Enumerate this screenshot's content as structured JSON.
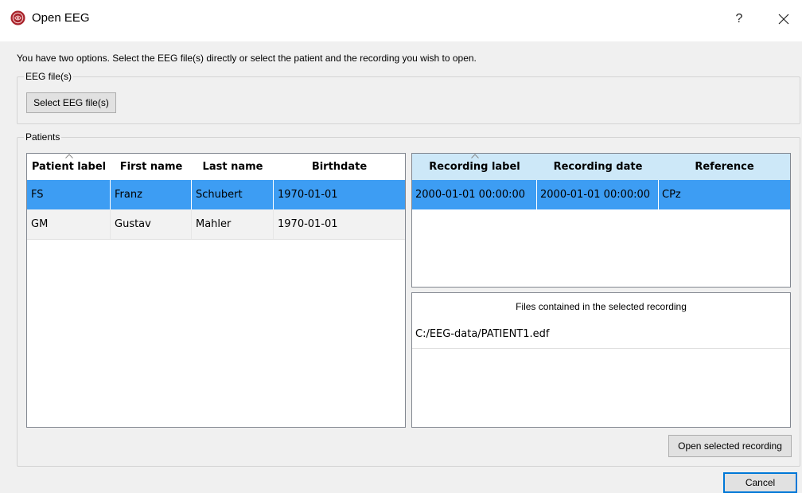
{
  "window": {
    "title": "Open EEG",
    "help_label": "?",
    "close_label": "✕",
    "icon": "brain-app-icon"
  },
  "intro_text": "You have two options. Select the EEG file(s) directly or select the patient and the recording you wish to open.",
  "eeg_files_group": {
    "title": "EEG file(s)",
    "select_button_label": "Select EEG file(s)"
  },
  "patients_group": {
    "title": "Patients",
    "patients_table": {
      "columns": [
        "Patient label",
        "First name",
        "Last name",
        "Birthdate"
      ],
      "rows": [
        [
          "FS",
          "Franz",
          "Schubert",
          "1970-01-01"
        ],
        [
          "GM",
          "Gustav",
          "Mahler",
          "1970-01-01"
        ]
      ],
      "selected_index": 0
    },
    "recordings_table": {
      "columns": [
        "Recording label",
        "Recording date",
        "Reference"
      ],
      "rows": [
        [
          "2000-01-01 00:00:00",
          "2000-01-01 00:00:00",
          "CPz"
        ]
      ],
      "selected_index": 0
    },
    "files_panel": {
      "header": "Files contained in the selected recording",
      "files": [
        "C:/EEG-data/PATIENT1.edf"
      ]
    },
    "open_button_label": "Open selected recording"
  },
  "cancel_button_label": "Cancel",
  "colors": {
    "selection": "#3d9df3",
    "header_active": "#cde8f8",
    "button_focus_border": "#0078d7"
  }
}
